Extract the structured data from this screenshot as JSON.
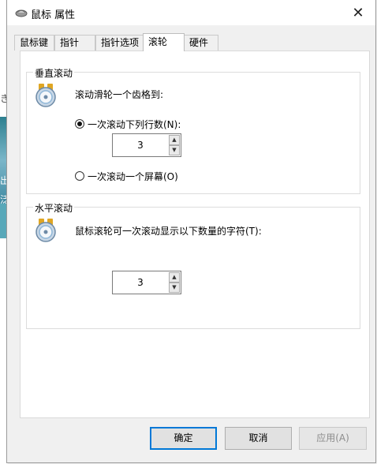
{
  "window": {
    "title": "鼠标 属性",
    "close_symbol": "✕"
  },
  "background_glyphs": [
    "き",
    "出",
    "泛"
  ],
  "tabs": [
    {
      "label": "鼠标键",
      "active": false
    },
    {
      "label": "指针",
      "active": false
    },
    {
      "label": "指针选项",
      "active": false
    },
    {
      "label": "滚轮",
      "active": true
    },
    {
      "label": "硬件",
      "active": false
    }
  ],
  "vertical": {
    "group_label": "垂直滚动",
    "description": "滚动滑轮一个齿格到:",
    "option_lines": {
      "label": "一次滚动下列行数(N):",
      "checked": true
    },
    "lines_value": "3",
    "option_screen": {
      "label": "一次滚动一个屏幕(O)",
      "checked": false
    }
  },
  "horizontal": {
    "group_label": "水平滚动",
    "description": "鼠标滚轮可一次滚动显示以下数量的字符(T):",
    "chars_value": "3"
  },
  "buttons": {
    "ok": "确定",
    "cancel": "取消",
    "apply": "应用(A)"
  },
  "colors": {
    "accent": "#0078d7",
    "icon_gold": "#e0a623",
    "icon_blue": "#8fb7d8"
  }
}
